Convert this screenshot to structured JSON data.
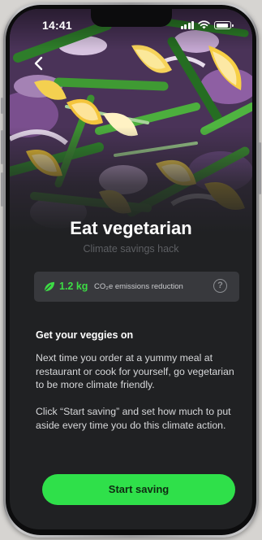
{
  "status_bar": {
    "time": "14:41",
    "icons": [
      "cellular-signal-icon",
      "wifi-icon",
      "battery-icon"
    ]
  },
  "hero": {
    "image": "vegetables-photo",
    "back_icon": "chevron-left-icon"
  },
  "header": {
    "title": "Eat vegetarian",
    "subtitle": "Climate savings hack"
  },
  "savings": {
    "icon": "leaf-icon",
    "amount": "1.2 kg",
    "label": "CO₂e emissions reduction",
    "help_icon": "question-circle-icon",
    "help_glyph": "?"
  },
  "content": {
    "heading": "Get your veggies on",
    "paragraph_1": "Next time you order at a yummy meal at restaurant or cook for yourself, go vegetarian to be more climate friendly.",
    "paragraph_2": "Click “Start saving” and set how much to put aside every time you do this climate action."
  },
  "cta": {
    "label": "Start saving"
  },
  "colors": {
    "background": "#202123",
    "card": "#38393d",
    "accent_green": "#2fe04a",
    "amount_green": "#3ddc45",
    "subtitle_gray": "#5d5f63"
  }
}
